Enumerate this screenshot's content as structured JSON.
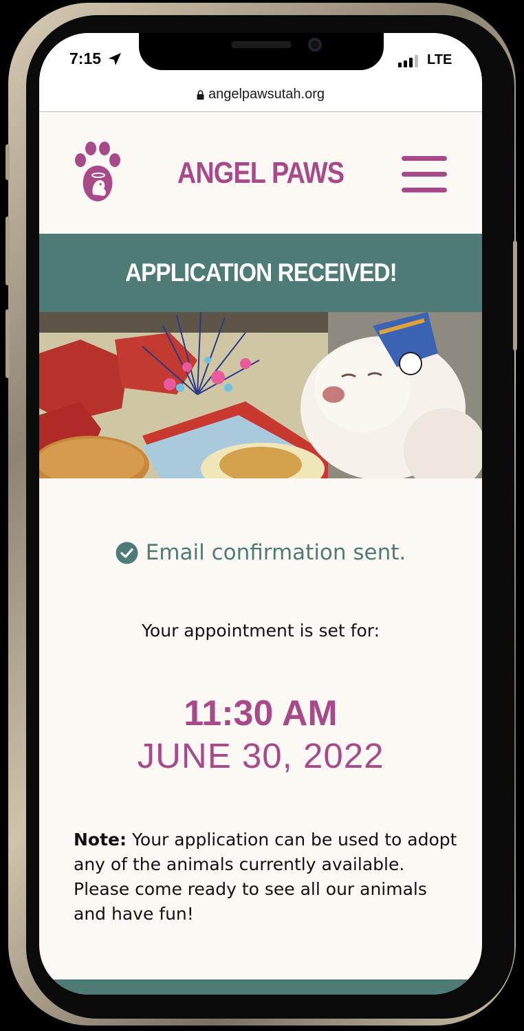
{
  "status_bar": {
    "time": "7:15",
    "carrier": "LTE"
  },
  "browser": {
    "url": "angelpawsutah.org"
  },
  "header": {
    "brand": "ANGEL PAWS"
  },
  "banner": {
    "title": "APPLICATION RECEIVED!"
  },
  "confirmation": {
    "text": "Email confirmation sent."
  },
  "appointment": {
    "label": "Your appointment is set for:",
    "time": "11:30 AM",
    "date": "JUNE 30, 2022"
  },
  "note": {
    "label": "Note:",
    "text": " Your application can be used to adopt any of the animals currently available. Please come ready to see all our animals and have fun!"
  },
  "colors": {
    "brand_purple": "#a84a8a",
    "teal": "#4e7b76",
    "page_bg": "#fcf9f4"
  },
  "icons": {
    "logo": "paw-angel-logo-icon",
    "menu": "hamburger-menu-icon",
    "check": "check-circle-icon",
    "lock": "lock-icon",
    "location": "location-arrow-icon",
    "signal": "signal-bars-icon"
  }
}
